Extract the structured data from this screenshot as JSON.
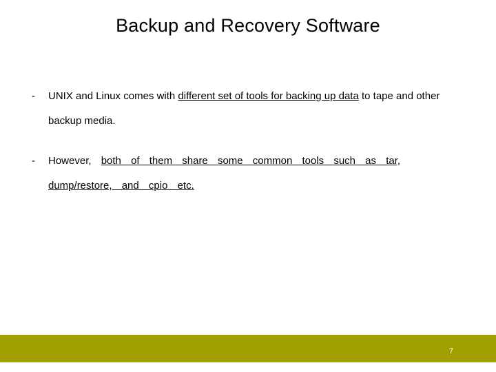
{
  "slide": {
    "title": "Backup and Recovery Software",
    "bullets": [
      {
        "pre": "UNIX and Linux comes with ",
        "underlined": "different set of tools for backing up data",
        "post": " to tape and other backup media."
      },
      {
        "pre": "However, ",
        "underlined": "both of them share some common tools such as tar, dump/restore, and cpio etc",
        "post": "."
      }
    ],
    "page_number": "7",
    "accent_color": "#a0a100"
  }
}
